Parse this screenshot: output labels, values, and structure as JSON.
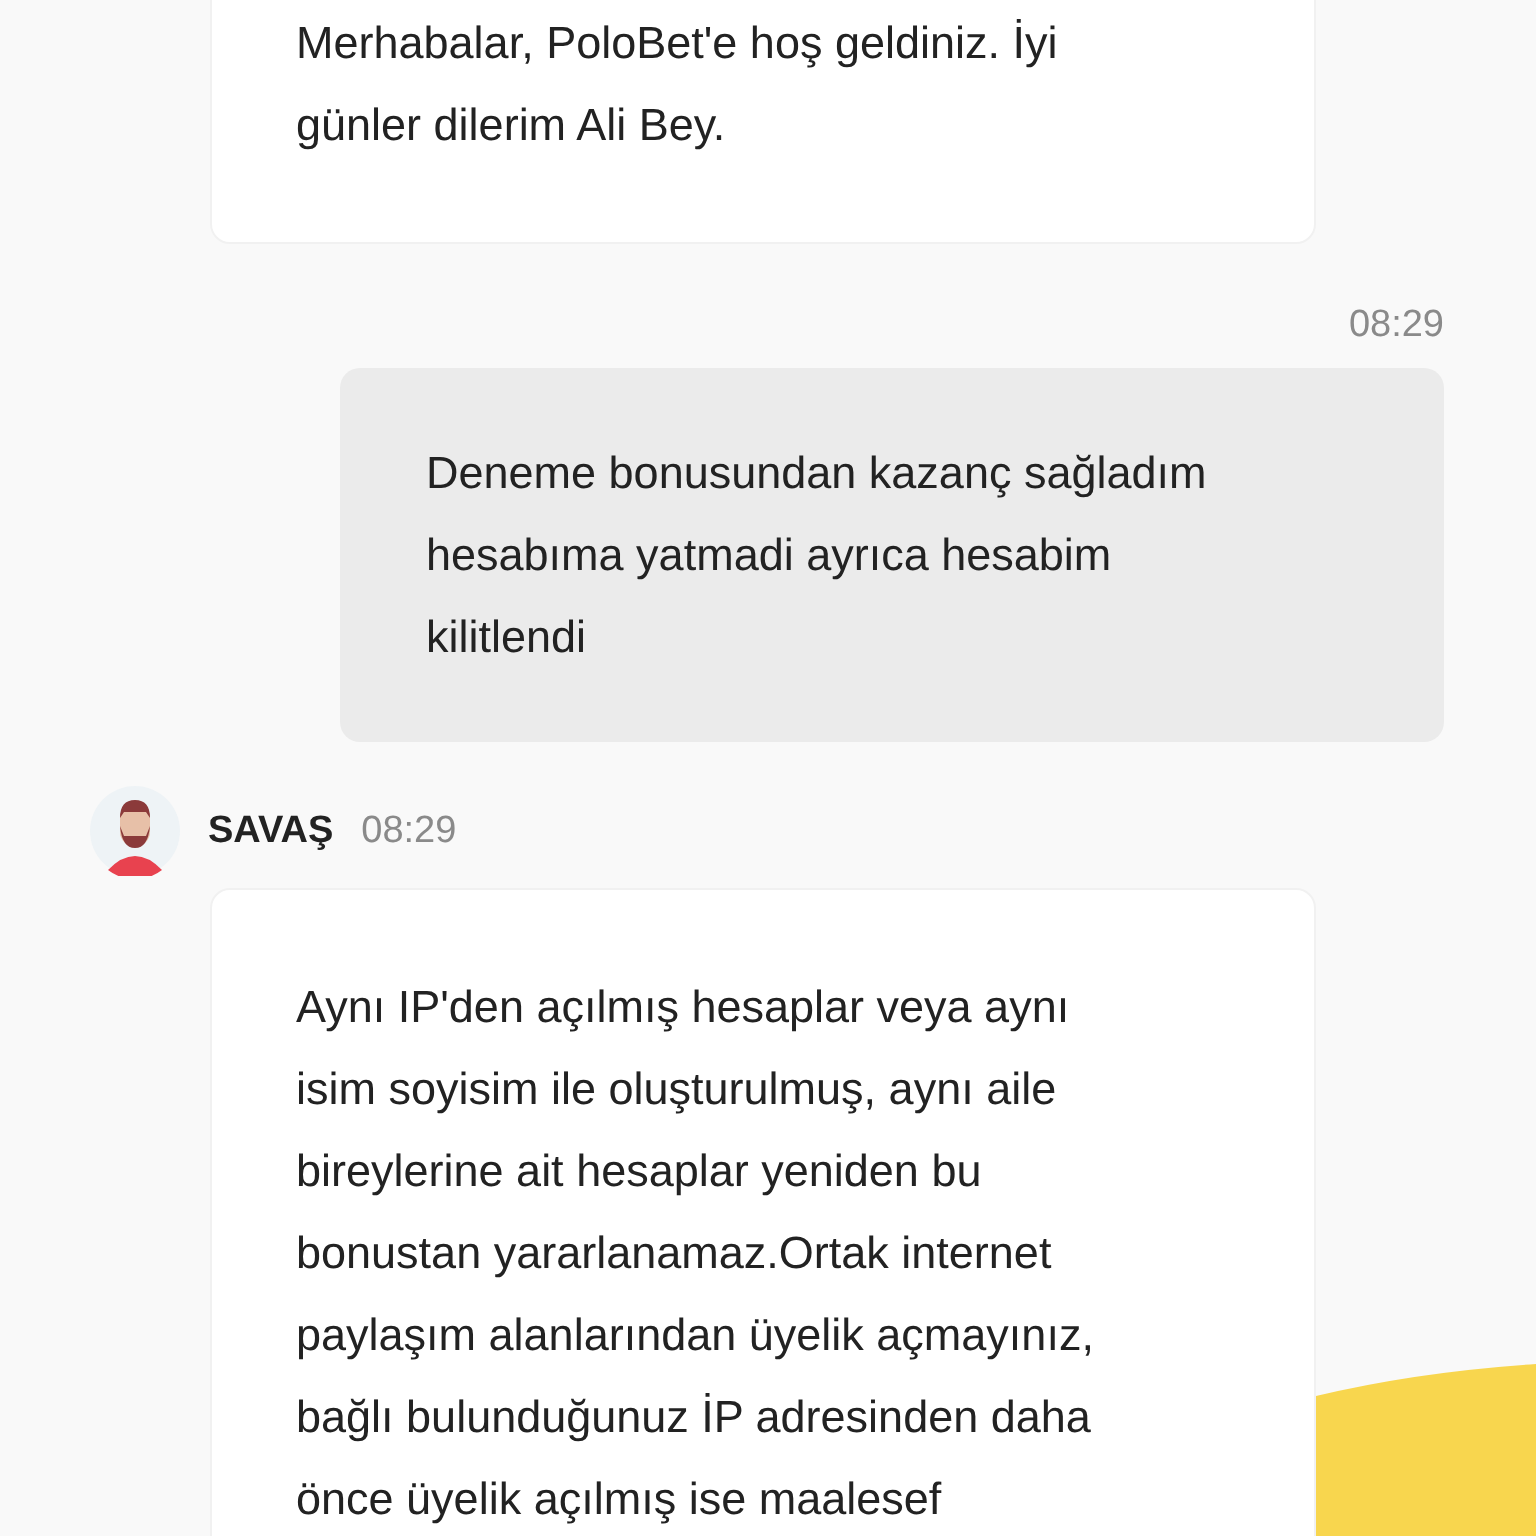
{
  "messages": [
    {
      "kind": "agent_card",
      "text": "Merhabalar, PoloBet'e hoş geldiniz. İyi\ngünler dilerim Ali Bey."
    },
    {
      "kind": "user",
      "time": "08:29",
      "text": "Deneme bonusundan kazanç sağladım\nhesabıma yatmadi ayrıca hesabim\nkilitlendi"
    },
    {
      "kind": "agent",
      "sender": "SAVAŞ",
      "time": "08:29",
      "text": "Aynı IP'den açılmış hesaplar veya aynı\nisim soyisim ile oluşturulmuş, aynı aile\nbireylerine ait hesaplar yeniden bu\nbonustan yararlanamaz.Ortak internet\npaylaşım alanlarından üyelik açmayınız,\nbağlı bulunduğunuz İP adresinden daha\nönce üyelik açılmış ise maalesef"
    }
  ]
}
